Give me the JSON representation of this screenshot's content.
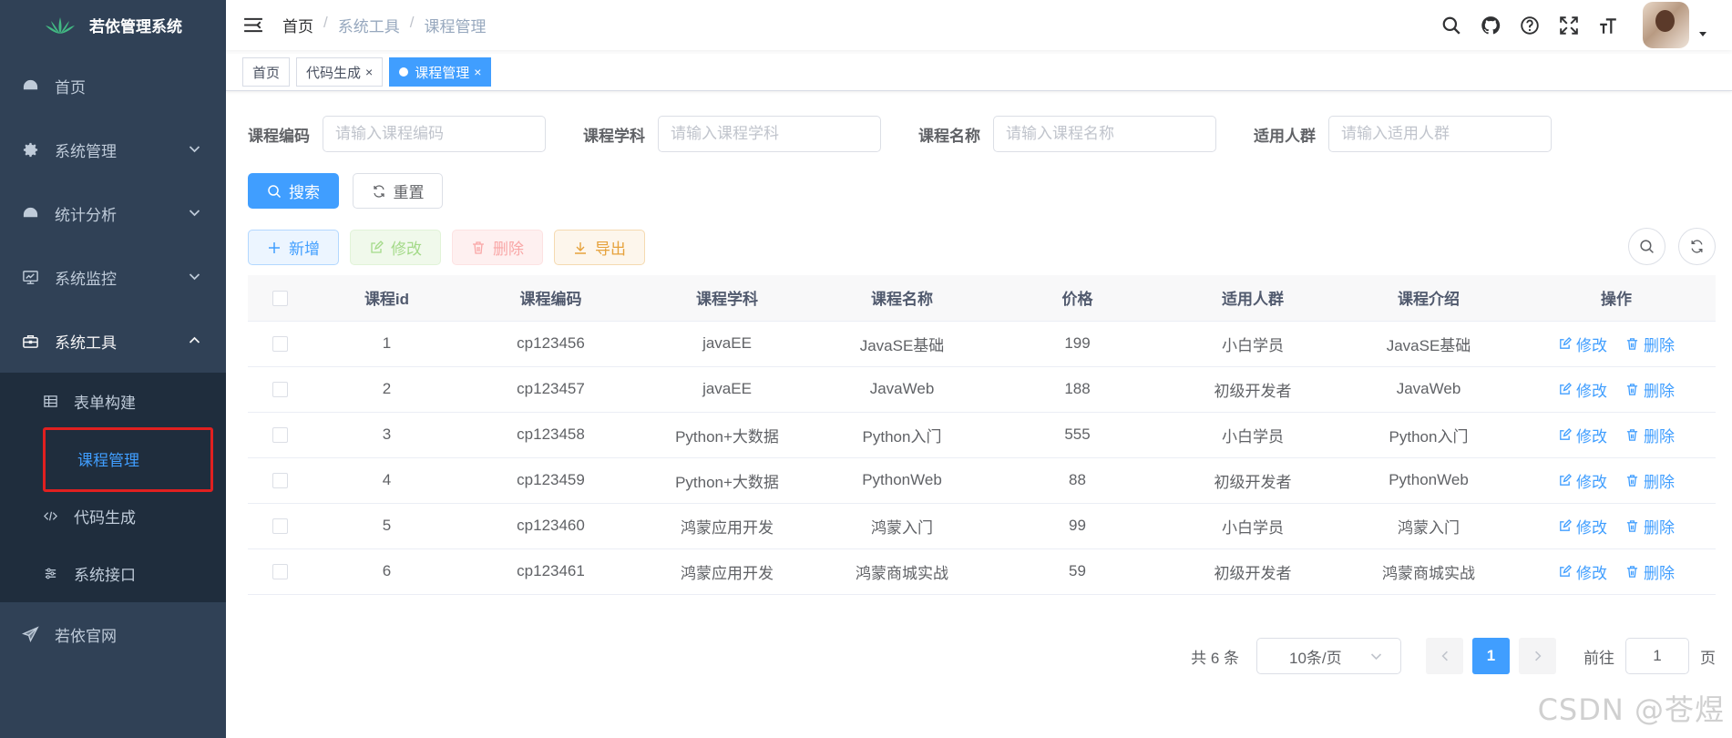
{
  "app": {
    "title": "若依管理系统"
  },
  "sidebar": {
    "items": [
      {
        "label": "首页",
        "icon": "dashboard-icon"
      },
      {
        "label": "系统管理",
        "icon": "gear-icon"
      },
      {
        "label": "统计分析",
        "icon": "dashboard-icon"
      },
      {
        "label": "系统监控",
        "icon": "monitor-icon"
      },
      {
        "label": "系统工具",
        "icon": "toolbox-icon"
      }
    ],
    "sub_items": [
      {
        "label": "表单构建",
        "icon": "table-icon"
      },
      {
        "label": "课程管理",
        "icon": ""
      },
      {
        "label": "代码生成",
        "icon": "code-icon"
      },
      {
        "label": "系统接口",
        "icon": "sliders-icon"
      }
    ],
    "footer_item": {
      "label": "若依官网",
      "icon": "send-icon"
    }
  },
  "breadcrumb": [
    "首页",
    "系统工具",
    "课程管理"
  ],
  "tags": [
    {
      "label": "首页"
    },
    {
      "label": "代码生成"
    },
    {
      "label": "课程管理"
    }
  ],
  "search": {
    "fields": [
      {
        "label": "课程编码",
        "placeholder": "请输入课程编码"
      },
      {
        "label": "课程学科",
        "placeholder": "请输入课程学科"
      },
      {
        "label": "课程名称",
        "placeholder": "请输入课程名称"
      },
      {
        "label": "适用人群",
        "placeholder": "请输入适用人群"
      }
    ],
    "search_label": "搜索",
    "reset_label": "重置"
  },
  "toolbar": {
    "add": "新增",
    "edit": "修改",
    "delete": "删除",
    "export": "导出"
  },
  "table": {
    "columns": [
      "课程id",
      "课程编码",
      "课程学科",
      "课程名称",
      "价格",
      "适用人群",
      "课程介绍",
      "操作"
    ],
    "rows": [
      [
        "1",
        "cp123456",
        "javaEE",
        "JavaSE基础",
        "199",
        "小白学员",
        "JavaSE基础"
      ],
      [
        "2",
        "cp123457",
        "javaEE",
        "JavaWeb",
        "188",
        "初级开发者",
        "JavaWeb"
      ],
      [
        "3",
        "cp123458",
        "Python+大数据",
        "Python入门",
        "555",
        "小白学员",
        "Python入门"
      ],
      [
        "4",
        "cp123459",
        "Python+大数据",
        "PythonWeb",
        "88",
        "初级开发者",
        "PythonWeb"
      ],
      [
        "5",
        "cp123460",
        "鸿蒙应用开发",
        "鸿蒙入门",
        "99",
        "小白学员",
        "鸿蒙入门"
      ],
      [
        "6",
        "cp123461",
        "鸿蒙应用开发",
        "鸿蒙商城实战",
        "59",
        "初级开发者",
        "鸿蒙商城实战"
      ]
    ],
    "op_edit": "修改",
    "op_delete": "删除"
  },
  "pagination": {
    "total_text": "共 6 条",
    "page_size": "10条/页",
    "current_page": "1",
    "goto_prefix": "前往",
    "goto_value": "1",
    "goto_suffix": "页"
  },
  "watermark": "CSDN @苍煜",
  "colors": {
    "sidebar_bg": "#304156",
    "primary": "#409eff",
    "highlight": "#e02020"
  }
}
